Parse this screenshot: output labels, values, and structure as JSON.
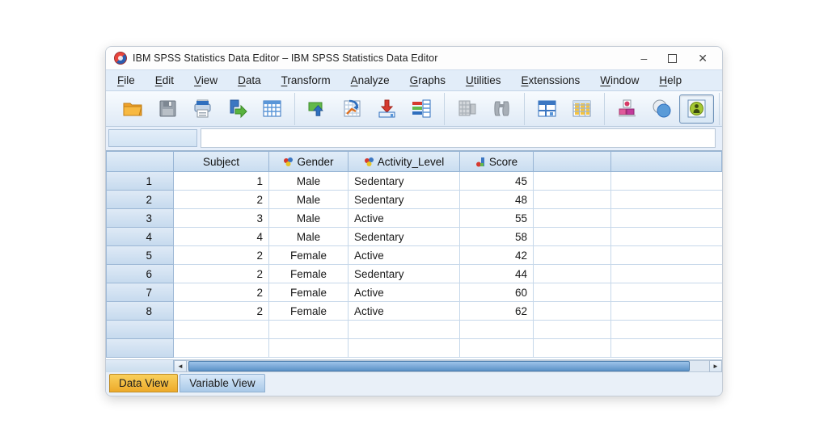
{
  "window": {
    "title": "IBM SPSS Statistics Data Editor – IBM SPSS Statistics Data Editor",
    "controls": {
      "minimize": "–",
      "close": "✕"
    }
  },
  "menu": {
    "items": [
      {
        "label": "File"
      },
      {
        "label": "Edit"
      },
      {
        "label": "View"
      },
      {
        "label": "Data"
      },
      {
        "label": "Transform"
      },
      {
        "label": "Analyze"
      },
      {
        "label": "Graphs"
      },
      {
        "label": "Utilities"
      },
      {
        "label": "Extenssions"
      },
      {
        "label": "Window"
      },
      {
        "label": "Help"
      }
    ]
  },
  "toolbar": {
    "icons": [
      "open-file",
      "save",
      "print",
      "export-data",
      "data-grid",
      "recall-dialogs",
      "goto-chart",
      "goto-case",
      "goto-variable",
      "split-file",
      "find",
      "insert-cases",
      "insert-variable",
      "use-variable-sets",
      "select-cases",
      "value-labels-toggle"
    ]
  },
  "cell_reference": {
    "name": "",
    "editor_value": ""
  },
  "grid": {
    "columns": [
      {
        "label": "Subject",
        "icon": null
      },
      {
        "label": "Gender",
        "icon": "nominal-measure"
      },
      {
        "label": "Activity_Level",
        "icon": "nominal-measure"
      },
      {
        "label": "Score",
        "icon": "scale-measure"
      },
      {
        "label": "",
        "icon": null
      },
      {
        "label": "",
        "icon": null
      }
    ],
    "rows": [
      {
        "n": "1",
        "cells": [
          "1",
          "Male",
          "Sedentary",
          "45",
          "",
          ""
        ]
      },
      {
        "n": "2",
        "cells": [
          "2",
          "Male",
          "Sedentary",
          "48",
          "",
          ""
        ]
      },
      {
        "n": "3",
        "cells": [
          "3",
          "Male",
          "Active",
          "55",
          "",
          ""
        ]
      },
      {
        "n": "4",
        "cells": [
          "4",
          "Male",
          "Sedentary",
          "58",
          "",
          ""
        ]
      },
      {
        "n": "5",
        "cells": [
          "2",
          "Female",
          "Active",
          "42",
          "",
          ""
        ]
      },
      {
        "n": "6",
        "cells": [
          "2",
          "Female",
          "Sedentary",
          "44",
          "",
          ""
        ]
      },
      {
        "n": "7",
        "cells": [
          "2",
          "Female",
          "Active",
          "60",
          "",
          ""
        ]
      },
      {
        "n": "8",
        "cells": [
          "2",
          "Female",
          "Active",
          "62",
          "",
          ""
        ]
      },
      {
        "n": "",
        "cells": [
          "",
          "",
          "",
          "",
          "",
          ""
        ]
      },
      {
        "n": "",
        "cells": [
          "",
          "",
          "",
          "",
          "",
          ""
        ]
      }
    ]
  },
  "scrollbar": {
    "left_arrow": "◄",
    "right_arrow": "►"
  },
  "tabs": [
    {
      "label": "Data View",
      "active": true
    },
    {
      "label": "Variable View",
      "active": false
    }
  ],
  "colors": {
    "active_tab": "#edaa2a",
    "inactive_tab": "#a9c9e8",
    "header_fill": "#c9ddf0",
    "scroll_thumb": "#5c92c7"
  }
}
